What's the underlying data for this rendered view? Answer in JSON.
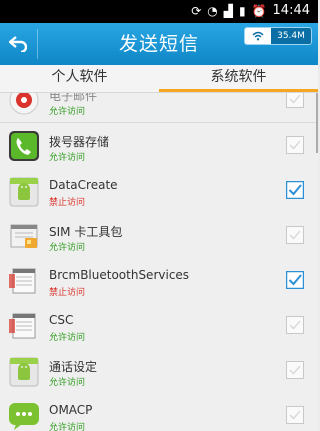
{
  "statusbar": {
    "time": "14:44"
  },
  "header": {
    "title": "发送短信",
    "net_value": "35.4M"
  },
  "tabs": [
    {
      "label": "个人软件",
      "active": false
    },
    {
      "label": "系统软件",
      "active": true
    }
  ],
  "apps": [
    {
      "name": "电子邮件",
      "status": "允许访问",
      "allowed": true,
      "checked": false,
      "icon": "email-icon"
    },
    {
      "name": "拨号器存储",
      "status": "允许访问",
      "allowed": true,
      "checked": false,
      "icon": "phone-icon"
    },
    {
      "name": "DataCreate",
      "status": "禁止访问",
      "allowed": false,
      "checked": true,
      "icon": "android-app-icon"
    },
    {
      "name": "SIM 卡工具包",
      "status": "允许访问",
      "allowed": true,
      "checked": false,
      "icon": "sim-toolkit-icon"
    },
    {
      "name": "BrcmBluetoothServices",
      "status": "禁止访问",
      "allowed": false,
      "checked": true,
      "icon": "generic-app-icon"
    },
    {
      "name": "CSC",
      "status": "允许访问",
      "allowed": true,
      "checked": false,
      "icon": "generic-app-icon"
    },
    {
      "name": "通话设定",
      "status": "允许访问",
      "allowed": true,
      "checked": false,
      "icon": "android-app-icon"
    },
    {
      "name": "OMACP",
      "status": "允许访问",
      "allowed": true,
      "checked": false,
      "icon": "chat-icon"
    }
  ],
  "colors": {
    "accent": "#1f97d6",
    "tab_indicator": "#f5a623",
    "allow": "#2e9b1e",
    "deny": "#d9332b",
    "checkbox": "#2d8fd5"
  }
}
